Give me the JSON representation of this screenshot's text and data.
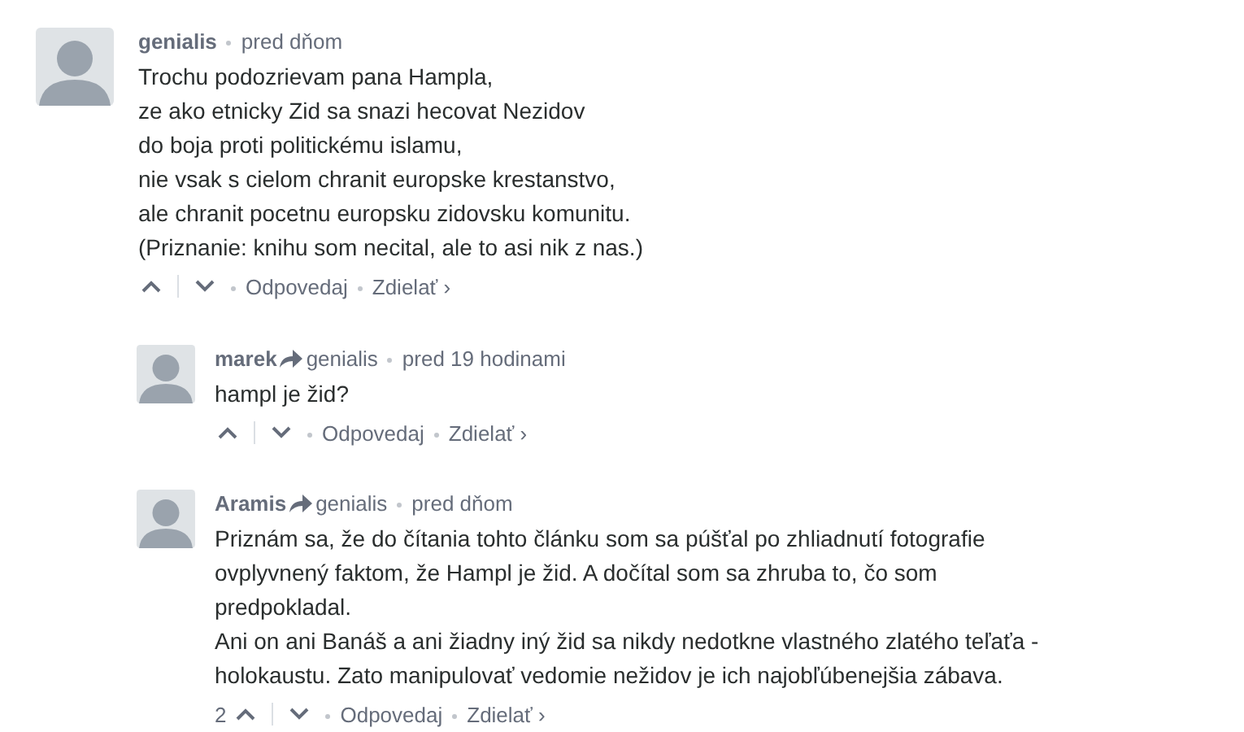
{
  "comments": [
    {
      "author": "genialis",
      "time": "pred dňom",
      "paragraphs": [
        "Trochu podozrievam pana Hampla,",
        "ze ako etnicky Zid sa snazi hecovat Nezidov",
        "do boja proti politickému islamu,",
        "nie vsak s cielom chranit europske krestanstvo,",
        "ale chranit pocetnu europsku zidovsku komunitu.",
        "(Priznanie: knihu som necital, ale to asi nik z nas.)"
      ],
      "actions": [
        "Odpovedaj",
        "Zdielať ›"
      ],
      "children": [
        {
          "author": "marek",
          "reply_to": "genialis",
          "time": "pred 19 hodinami",
          "paragraphs": [
            "hampl je žid?"
          ],
          "actions": [
            "Odpovedaj",
            "Zdielať ›"
          ]
        },
        {
          "author": "Aramis",
          "reply_to": "genialis",
          "time": "pred dňom",
          "paragraphs": [
            "Priznám sa, že do čítania tohto článku som sa púšťal po zhliadnutí fotografie ovplyvnený faktom, že Hampl je žid. A dočítal som sa zhruba to, čo som predpokladal.",
            "Ani on ani Banáš a ani žiadny iný žid sa nikdy nedotkne vlastného zlatého teľaťa - holokaustu. Zato manipulovať vedomie nežidov je ich najobľúbenejšia zábava."
          ],
          "votes": "2",
          "actions": [
            "Odpovedaj",
            "Zdielať ›"
          ]
        }
      ]
    }
  ]
}
